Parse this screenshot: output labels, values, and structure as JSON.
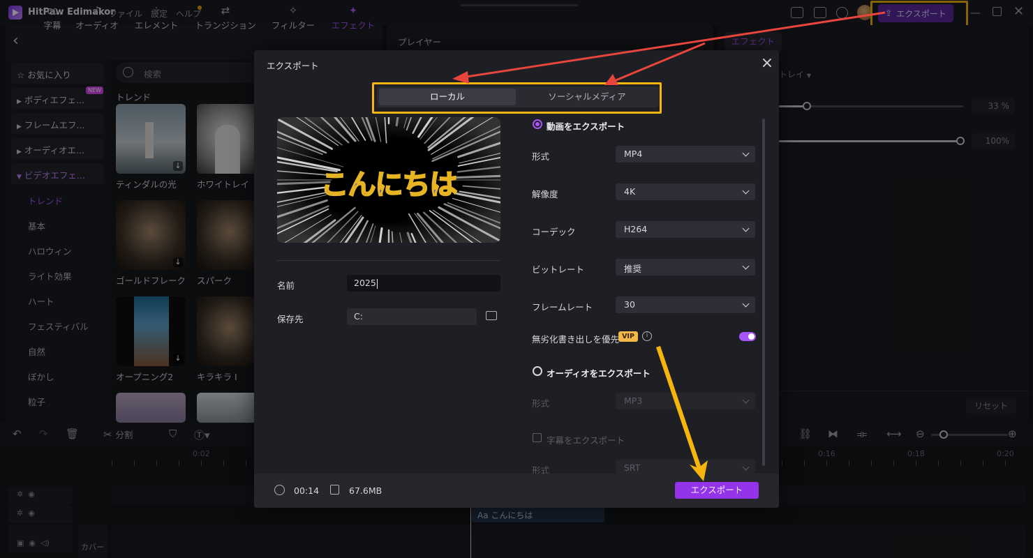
{
  "app": {
    "name": "HitPaw Edimakor",
    "menu": [
      "ファイル",
      "設定",
      "ヘルプ"
    ],
    "export_label": "エクスポート"
  },
  "toolbar_tabs": [
    {
      "label": "字幕",
      "icon": "cc-icon"
    },
    {
      "label": "オーディオ",
      "icon": "music-note-icon"
    },
    {
      "label": "エレメント",
      "icon": "shapes-icon"
    },
    {
      "label": "トランジション",
      "icon": "transition-arrows-icon"
    },
    {
      "label": "フィルター",
      "icon": "sparkle-icon"
    },
    {
      "label": "エフェクト",
      "icon": "magic-wand-icon",
      "active": true
    }
  ],
  "library": {
    "favorites": "お気に入り",
    "categories": [
      {
        "label": "ボディエフェ...",
        "badge": "NEW"
      },
      {
        "label": "フレームエフ..."
      },
      {
        "label": "オーディオエ..."
      },
      {
        "label": "ビデオエフェ...",
        "open": true
      }
    ],
    "subcategories": [
      "トレンド",
      "基本",
      "ハロウィン",
      "ライト効果",
      "ハート",
      "フェスティバル",
      "自然",
      "ぼかし",
      "粒子"
    ],
    "search_placeholder": "検索",
    "section_title": "トレンド",
    "thumbnails": [
      {
        "label": "ティンダルの光"
      },
      {
        "label": "ホワイトレイ"
      },
      {
        "label": "ゴールドフレーク"
      },
      {
        "label": "スパーク"
      },
      {
        "label": "オープニング2"
      },
      {
        "label": "キラキラ I"
      }
    ]
  },
  "player": {
    "title": "プレイヤー"
  },
  "right_panel": {
    "tab": "エフェクト",
    "dropdown_fragment": "トレイ",
    "slider1_value": "33 %",
    "slider2_value": "100%",
    "reset_label": "リセット"
  },
  "timeline": {
    "split_label": "分割",
    "ruler": [
      "0:02",
      "0:16",
      "0:18",
      "0:20"
    ],
    "cover_label": "カバー",
    "subtitle_clip": "Aa こんにちは"
  },
  "dialog": {
    "title": "エクスポート",
    "tabs": [
      "ローカル",
      "ソーシャルメディア"
    ],
    "preview_text": "こんにちは",
    "name_label": "名前",
    "name_value": "2025",
    "save_label": "保存先",
    "save_value": "C:",
    "video_export_label": "動画をエクスポート",
    "settings": [
      {
        "label": "形式",
        "value": "MP4"
      },
      {
        "label": "解像度",
        "value": "4K"
      },
      {
        "label": "コーデック",
        "value": "H264"
      },
      {
        "label": "ビットレート",
        "value": "推奨"
      },
      {
        "label": "フレームレート",
        "value": "30"
      }
    ],
    "lossless_label": "無劣化書き出しを優先",
    "vip_badge": "VIP",
    "audio_export_label": "オーディオをエクスポート",
    "audio_format_label": "形式",
    "audio_format_value": "MP3",
    "subtitle_export_label": "字幕をエクスポート",
    "subtitle_format_label": "形式",
    "subtitle_format_value": "SRT",
    "duration": "00:14",
    "size": "67.6MB",
    "export_button": "エクスポート"
  },
  "colors": {
    "accent": "#a855f7",
    "annotation": "#f6b50c",
    "arrow_red": "#e8453c"
  }
}
